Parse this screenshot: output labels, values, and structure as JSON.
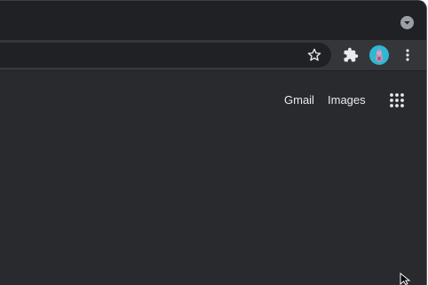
{
  "browser": {
    "tab_search_icon": "chevron-down-circle-icon",
    "toolbar": {
      "bookmark_icon": "star-outline-icon",
      "extensions_icon": "puzzle-piece-icon",
      "profile_icon": "avatar",
      "menu_icon": "vertical-dots-icon"
    }
  },
  "page": {
    "links": {
      "gmail": "Gmail",
      "images": "Images"
    },
    "apps_icon": "grid-dots-icon"
  },
  "colors": {
    "frame": "#202124",
    "toolbar": "#35363a",
    "content": "#292a2d",
    "text": "#e8eaed",
    "icon": "#9aa0a6",
    "avatar": "#2eb8d3"
  }
}
